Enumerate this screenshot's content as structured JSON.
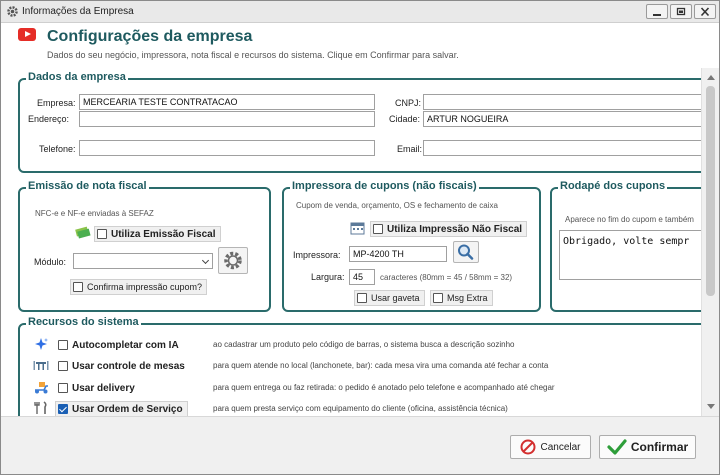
{
  "window": {
    "title": "Informações da Empresa"
  },
  "header": {
    "title": "Configurações da empresa",
    "subtitle": "Dados do seu negócio, impressora, nota fiscal e recursos do sistema. Clique em Confirmar para salvar."
  },
  "empresa": {
    "legend": "Dados da empresa",
    "empresa_label": "Empresa:",
    "empresa_value": "MERCEARIA TESTE CONTRATACAO",
    "cnpj_label": "CNPJ:",
    "cnpj_value": "",
    "endereco_label": "Endereço:",
    "endereco_value": "",
    "cidade_label": "Cidade:",
    "cidade_value": "ARTUR NOGUEIRA",
    "telefone_label": "Telefone:",
    "telefone_value": "",
    "email_label": "Email:",
    "email_value": ""
  },
  "nota_fiscal": {
    "legend": "Emissão de nota fiscal",
    "hint": "NFC-e e NF-e enviadas à SEFAZ",
    "emissao_label": "Utiliza Emissão Fiscal",
    "emissao_checked": false,
    "modulo_label": "Módulo:",
    "modulo_value": "",
    "confirma_label": "Confirma impressão cupom?",
    "confirma_checked": false
  },
  "impressora": {
    "legend": "Impressora de cupons (não fiscais)",
    "hint": "Cupom de venda, orçamento, OS e fechamento de caixa",
    "nao_fiscal_label": "Utiliza Impressão Não Fiscal",
    "nao_fiscal_checked": false,
    "impressora_label": "Impressora:",
    "impressora_value": "MP-4200 TH",
    "largura_label": "Largura:",
    "largura_value": "45",
    "largura_hint": "caracteres (80mm = 45 / 58mm = 32)",
    "gaveta_label": "Usar gaveta",
    "gaveta_checked": false,
    "msg_extra_label": "Msg Extra",
    "msg_extra_checked": false
  },
  "rodape": {
    "legend": "Rodapé dos cupons",
    "hint": "Aparece no fim do cupom e também",
    "text": "Obrigado, volte sempr"
  },
  "recursos": {
    "legend": "Recursos do sistema",
    "items": [
      {
        "label": "Autocompletar com IA",
        "desc": "ao cadastrar um produto pelo código de barras, o sistema busca a descrição sozinho",
        "checked": false
      },
      {
        "label": "Usar controle de mesas",
        "desc": "para quem atende no local (lanchonete, bar): cada mesa vira uma comanda até fechar a conta",
        "checked": false
      },
      {
        "label": "Usar delivery",
        "desc": "para quem entrega ou faz retirada: o pedido é anotado pelo telefone e acompanhado até chegar",
        "checked": false
      },
      {
        "label": "Usar Ordem de Serviço",
        "desc": "para quem presta serviço com equipamento do cliente (oficina, assistência técnica)",
        "checked": true
      }
    ]
  },
  "footer": {
    "cancel_label": "Cancelar",
    "confirm_label": "Confirmar"
  },
  "colors": {
    "accent": "#1e5a5f",
    "checkbox_checked": "#1a5fb4",
    "cancel_icon": "#d32f2f",
    "confirm_icon": "#2e9e3a"
  }
}
